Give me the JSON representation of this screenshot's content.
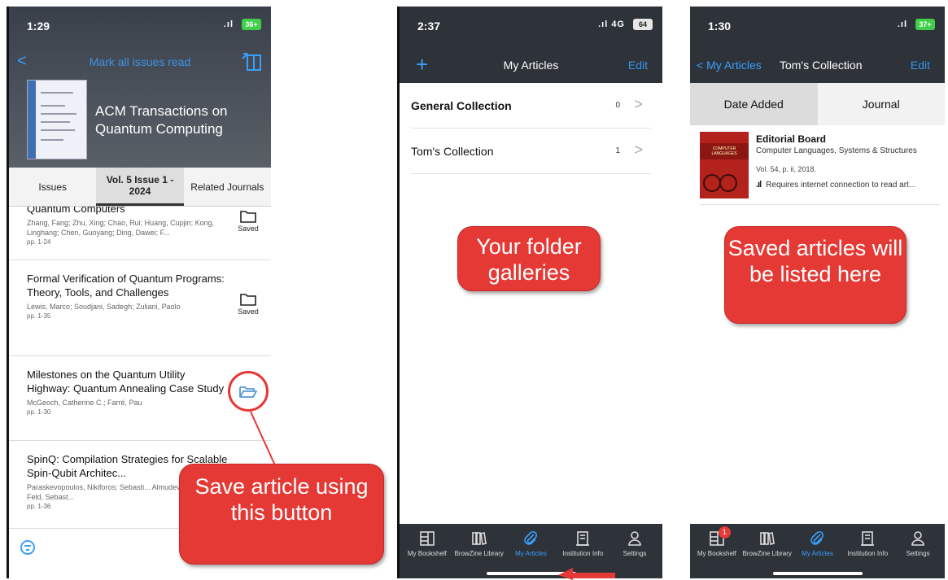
{
  "phone1": {
    "status": {
      "time": "1:29",
      "signal": ".ıl",
      "battery": "36+"
    },
    "nav": {
      "back": "<",
      "mark_all": "Mark all issues read"
    },
    "journal_title": "ACM Transactions on Quantum Computing",
    "tabs": [
      {
        "label": "Issues",
        "active": false
      },
      {
        "label": "Vol. 5 Issue 1 - 2024",
        "active": true
      },
      {
        "label": "Related Journals",
        "active": false
      }
    ],
    "articles": [
      {
        "title": "Quantum Computers",
        "authors": "Zhang, Fang; Zhu, Xing; Chao, Rui; Huang, Cupjin; Kong, Linghang; Chen, Guoyang; Ding, Dawei; F...",
        "pages": "pp. 1-24",
        "save_label": "Saved"
      },
      {
        "title": "Formal Verification of Quantum Programs: Theory, Tools, and Challenges",
        "authors": "Lewis, Marco; Soudjani, Sadegh; Zuliani, Paolo",
        "pages": "pp. 1-35",
        "save_label": "Saved"
      },
      {
        "title": "Milestones on the Quantum Utility Highway: Quantum Annealing Case Study",
        "authors": "McGeoch, Catherine C.; Farré, Pau",
        "pages": "pp. 1-30",
        "save_label": ""
      },
      {
        "title": "SpinQ: Compilation Strategies for Scalable Spin-Qubit Architec...",
        "authors": "Paraskevopoulos, Nikiforos; Sebasti... Almudever, Carmen G.; Feld, Sebast...",
        "pages": "pp. 1-36",
        "save_label": ""
      }
    ],
    "callout": "Save article using this button"
  },
  "phone2": {
    "status": {
      "time": "2:37",
      "signal": ".ıl 4G",
      "battery": "64"
    },
    "nav": {
      "plus": "+",
      "title": "My Articles",
      "edit": "Edit"
    },
    "collections": [
      {
        "name": "General Collection",
        "count": "0",
        "chevron": ">"
      },
      {
        "name": "Tom's Collection",
        "count": "1",
        "chevron": ">"
      }
    ],
    "callout": "Your folder galleries"
  },
  "phone3": {
    "status": {
      "time": "1:30",
      "signal": ".ıl",
      "battery": "37+"
    },
    "nav": {
      "back": "< My Articles",
      "title": "Tom's Collection",
      "edit": "Edit"
    },
    "segments": [
      {
        "label": "Date Added",
        "active": true
      },
      {
        "label": "Journal",
        "active": false
      }
    ],
    "entry": {
      "cover_text": "COMPUTER LANGUAGES",
      "title": "Editorial Board",
      "journal": "Computer Languages, Systems & Structures",
      "volume": "Vol. 54, p. ii, 2018.",
      "requires": "Requires internet connection to read art..."
    },
    "callout": "Saved articles will be listed here"
  },
  "tabbar": [
    {
      "label": "My Bookshelf",
      "icon": "bookshelf-icon"
    },
    {
      "label": "BrowZine Library",
      "icon": "library-icon"
    },
    {
      "label": "My Articles",
      "icon": "paperclip-icon"
    },
    {
      "label": "Institution Info",
      "icon": "building-icon"
    },
    {
      "label": "Settings",
      "icon": "person-icon"
    }
  ],
  "tabbar_badge": "1",
  "colors": {
    "accent": "#3aa0ff",
    "callout": "#e53935",
    "dark_header": "#2e3239"
  }
}
